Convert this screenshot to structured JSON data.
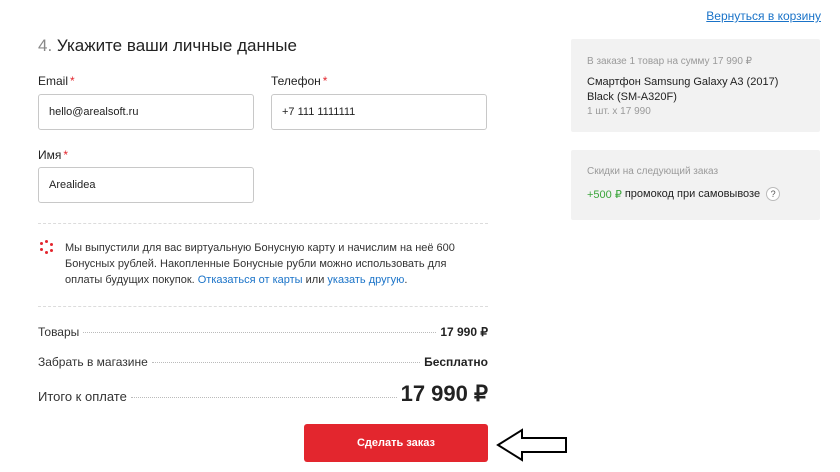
{
  "header": {
    "back_link": "Вернуться в корзину"
  },
  "section": {
    "number": "4.",
    "title": "Укажите ваши личные данные"
  },
  "form": {
    "email": {
      "label": "Email",
      "required_mark": "*",
      "value": "hello@arealsoft.ru"
    },
    "phone": {
      "label": "Телефон",
      "required_mark": "*",
      "value": "+7 111 1111111"
    },
    "name": {
      "label": "Имя",
      "required_mark": "*",
      "value": "Arealidea"
    }
  },
  "bonus": {
    "text": "Мы выпустили для вас виртуальную Бонусную карту и начислим на неё 600 Бонусных рублей. Накопленные Бонусные рубли можно использовать для оплаты будущих покупок.",
    "decline_link": "Отказаться от карты",
    "or": "или",
    "other_link": "указать другую",
    "end": "."
  },
  "summary": {
    "goods_label": "Товары",
    "goods_value": "17 990 ₽",
    "pickup_label": "Забрать в магазине",
    "pickup_value": "Бесплатно",
    "total_label": "Итого к оплате",
    "total_value": "17 990 ₽"
  },
  "submit_label": "Сделать заказ",
  "order_box": {
    "summary": "В заказе 1 товар на сумму 17 990 ₽",
    "product": "Смартфон Samsung Galaxy A3 (2017) Black (SM-A320F)",
    "quantity": "1 шт. x 17 990"
  },
  "discount_box": {
    "title": "Скидки на следующий заказ",
    "amount": "+500 ₽",
    "text": "промокод при самовывозе",
    "help": "?"
  },
  "colors": {
    "accent": "#e3262e",
    "link": "#1a73c8",
    "promo": "#3aa53a",
    "panel": "#f2f2f2"
  },
  "icons": [
    "bonus-card-icon",
    "help-icon",
    "pointer-arrow-icon"
  ]
}
